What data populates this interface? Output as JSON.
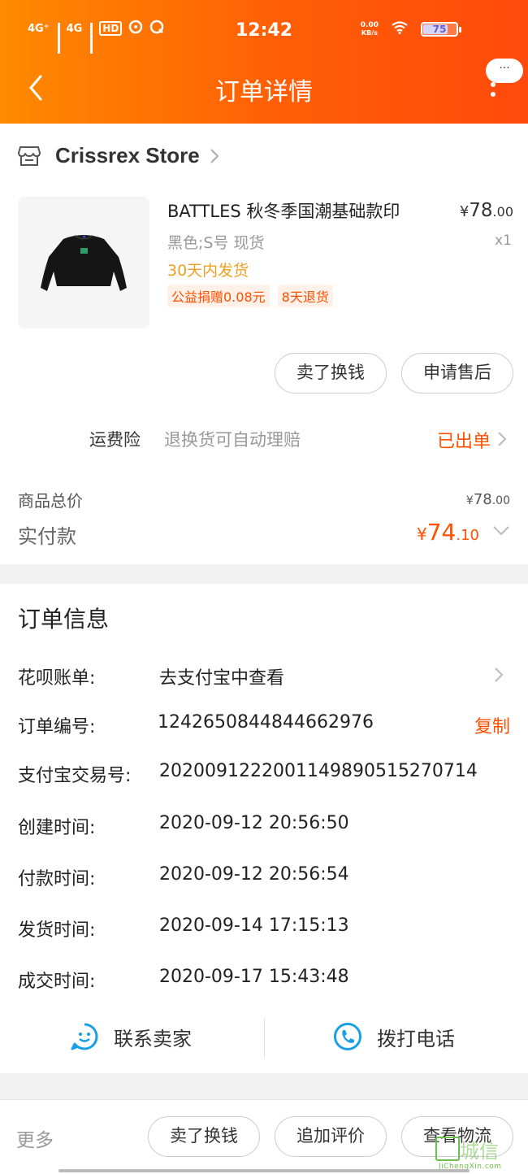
{
  "status_bar": {
    "time": "12:42",
    "net1": "4G⁺",
    "net2": "4G",
    "hd": "HD",
    "speed_value": "0.00",
    "speed_unit": "KB/s",
    "battery": "75"
  },
  "header": {
    "title": "订单详情",
    "menu_bubble": "···"
  },
  "store": {
    "name": "Crissrex Store"
  },
  "product": {
    "title": "BATTLES 秋冬季国潮基础款印",
    "price_symbol": "¥",
    "price_int": "78",
    "price_dec": ".00",
    "sku": "黑色;S号 现货",
    "qty": "x1",
    "ship_note": "30天内发货",
    "tags": [
      "公益捐赠0.08元",
      "8天退货"
    ]
  },
  "item_actions": {
    "sell": "卖了换钱",
    "after_sale": "申请售后"
  },
  "insurance": {
    "label": "运费险",
    "desc": "退换货可自动理赔",
    "status": "已出单"
  },
  "summary": {
    "total_label": "商品总价",
    "total_symbol": "¥",
    "total_int": "78",
    "total_dec": ".00",
    "paid_label": "实付款",
    "paid_symbol": "¥",
    "paid_int": "74",
    "paid_dec": ".10"
  },
  "order_info": {
    "title": "订单信息",
    "rows": [
      {
        "label": "花呗账单:",
        "value": "去支付宝中查看"
      },
      {
        "label": "订单编号:",
        "value": "1242650844844662976",
        "action": "复制"
      },
      {
        "label": "支付宝交易号:",
        "value": "2020091222001149890515270714"
      },
      {
        "label": "创建时间:",
        "value": "2020-09-12 20:56:50"
      },
      {
        "label": "付款时间:",
        "value": "2020-09-12 20:56:54"
      },
      {
        "label": "发货时间:",
        "value": "2020-09-14 17:15:13"
      },
      {
        "label": "成交时间:",
        "value": "2020-09-17 15:43:48"
      }
    ]
  },
  "contact": {
    "seller": "联系卖家",
    "phone": "拨打电话"
  },
  "bottom_bar": {
    "more": "更多",
    "sell": "卖了换钱",
    "review": "追加评价",
    "logistics": "查看物流"
  },
  "watermark": {
    "main": "城信",
    "sub": "JiChengXin.com"
  },
  "colors": {
    "accent": "#ff5000",
    "header_start": "#ff8a00",
    "header_end": "#ff4a0c",
    "ship_note": "#f0a020",
    "icon_blue": "#1aa0e6"
  },
  "icons": {
    "back": "chevron-left-icon",
    "store": "store-icon",
    "chat": "smiley-chat-icon",
    "phone": "phone-icon"
  }
}
